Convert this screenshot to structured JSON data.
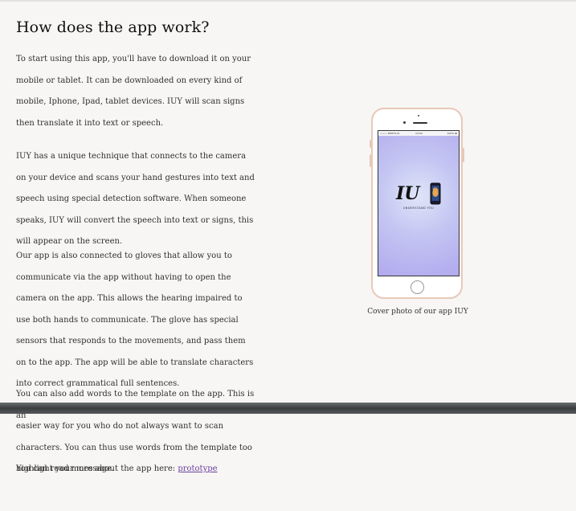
{
  "article": {
    "title": "How does the app work?",
    "paragraphs": [
      "To start using this app, you'll have to download it on your mobile or tablet. It can be downloaded on every kind of mobile, Iphone, Ipad, tablet devices. IUY will scan signs then translate it into text or speech.",
      "IUY has a unique technique that connects to the camera on your device and scans your hand gestures into text and speech using special detection software. When someone speaks, IUY will convert the speech into text or signs, this will appear on the screen.",
      "Our app is also connected to gloves that allow you to communicate via the app without having to open the camera on the app. This allows the hearing impaired to use both hands to communicate. The glove has special sensors that responds to the movements, and pass them on to the app. The app will be able to translate characters into correct grammatical full sentences.",
      "You can also add words to the template on the app. This is an",
      "easier way for you who do not always want to scan characters. You can thus use words from the template too highlight your message."
    ],
    "readmore_prefix": "You can read more about the app here: ",
    "readmore_link": "prototype"
  },
  "figure": {
    "caption": "Cover photo of our app IUY",
    "phone": {
      "status_carrier": "••••• PROTO.IO",
      "status_time": "10:00",
      "status_battery": "100% ▬",
      "logo_text": "IU",
      "tagline": "UNDERSTAND YOU",
      "home_button_icon": "home-button-icon"
    }
  },
  "colors": {
    "background": "#f7f6f4",
    "link": "#6b3fa0",
    "phone_frame": "#e8c8b8",
    "screen_gradient_center": "#dfe5f8",
    "screen_gradient_edge": "#b1a9ee"
  }
}
